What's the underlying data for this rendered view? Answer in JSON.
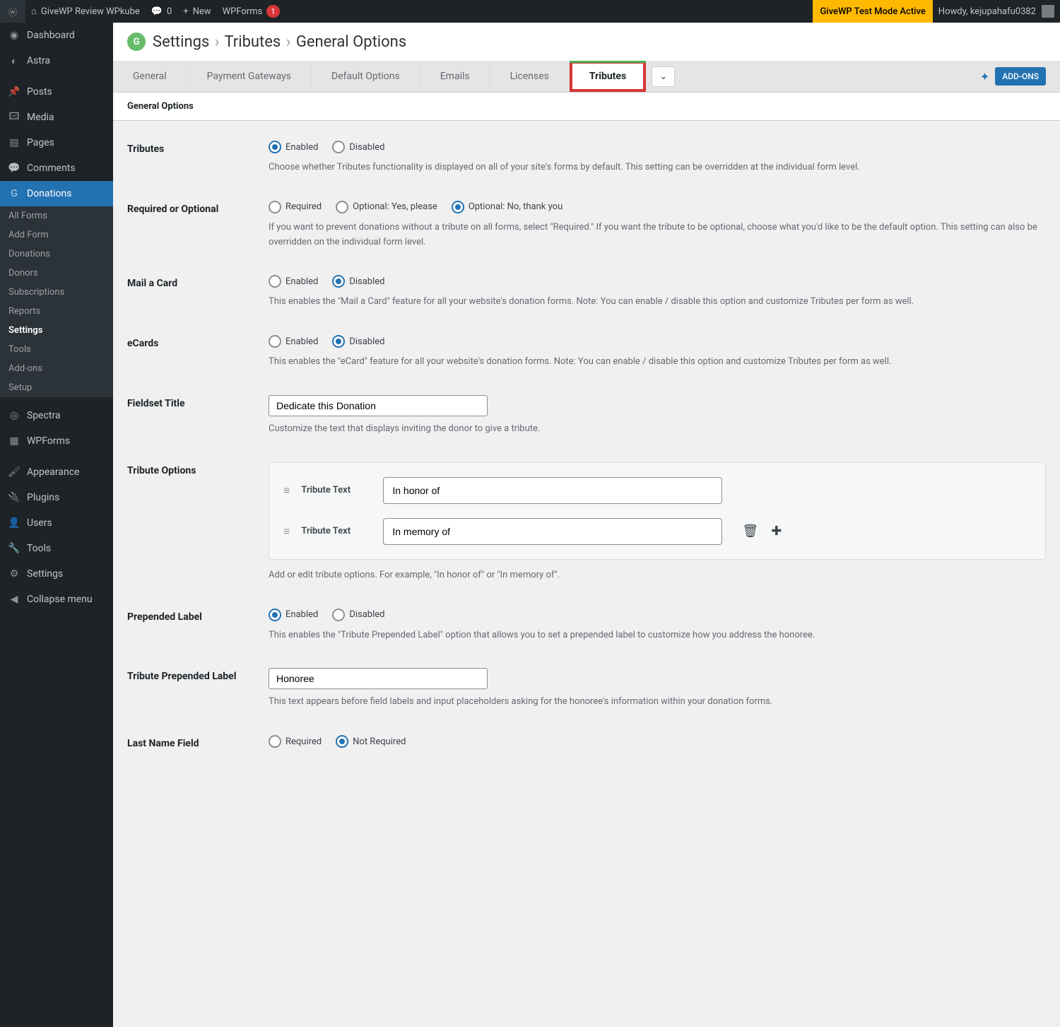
{
  "topbar": {
    "site_name": "GiveWP Review WPkube",
    "comments_count": "0",
    "new_label": "New",
    "wpforms_label": "WPForms",
    "wpforms_badge": "1",
    "test_mode": "GiveWP Test Mode Active",
    "howdy": "Howdy, kejupahafu0382"
  },
  "sidebar": {
    "items": [
      {
        "icon": "dashboard",
        "label": "Dashboard"
      },
      {
        "icon": "astra",
        "label": "Astra"
      },
      {
        "icon": "pin",
        "label": "Posts"
      },
      {
        "icon": "media",
        "label": "Media"
      },
      {
        "icon": "page",
        "label": "Pages"
      },
      {
        "icon": "comment",
        "label": "Comments"
      },
      {
        "icon": "give",
        "label": "Donations"
      }
    ],
    "submenu": [
      {
        "label": "All Forms"
      },
      {
        "label": "Add Form"
      },
      {
        "label": "Donations"
      },
      {
        "label": "Donors"
      },
      {
        "label": "Subscriptions"
      },
      {
        "label": "Reports"
      },
      {
        "label": "Settings",
        "active": true
      },
      {
        "label": "Tools"
      },
      {
        "label": "Add-ons"
      },
      {
        "label": "Setup"
      }
    ],
    "bottom": [
      {
        "icon": "spectra",
        "label": "Spectra"
      },
      {
        "icon": "wpforms",
        "label": "WPForms"
      },
      {
        "icon": "appearance",
        "label": "Appearance"
      },
      {
        "icon": "plugins",
        "label": "Plugins"
      },
      {
        "icon": "users",
        "label": "Users"
      },
      {
        "icon": "tools",
        "label": "Tools"
      },
      {
        "icon": "settings",
        "label": "Settings"
      },
      {
        "icon": "collapse",
        "label": "Collapse menu"
      }
    ]
  },
  "heading": {
    "crumb1": "Settings",
    "crumb2": "Tributes",
    "crumb3": "General Options"
  },
  "tabs": {
    "items": [
      "General",
      "Payment Gateways",
      "Default Options",
      "Emails",
      "Licenses",
      "Tributes"
    ],
    "addons": "ADD-ONS"
  },
  "subnav": "General Options",
  "options": {
    "enabled": "Enabled",
    "disabled": "Disabled",
    "required": "Required",
    "not_required": "Not Required",
    "optional_yes": "Optional: Yes, please",
    "optional_no": "Optional: No, thank you"
  },
  "rows": {
    "tributes": {
      "label": "Tributes",
      "desc": "Choose whether Tributes functionality is displayed on all of your site's forms by default. This setting can be overridden at the individual form level."
    },
    "required": {
      "label": "Required or Optional",
      "desc": "If you want to prevent donations without a tribute on all forms, select \"Required.\" If you want the tribute to be optional, choose what you'd like to be the default option. This setting can also be overridden on the individual form level."
    },
    "mail_card": {
      "label": "Mail a Card",
      "desc": "This enables the \"Mail a Card\" feature for all your website's donation forms. Note: You can enable / disable this option and customize Tributes per form as well."
    },
    "ecards": {
      "label": "eCards",
      "desc": "This enables the \"eCard\" feature for all your website's donation forms. Note: You can enable / disable this option and customize Tributes per form as well."
    },
    "fieldset": {
      "label": "Fieldset Title",
      "value": "Dedicate this Donation",
      "desc": "Customize the text that displays inviting the donor to give a tribute."
    },
    "tribute_opts": {
      "label": "Tribute Options",
      "text_label": "Tribute Text",
      "r1": "In honor of",
      "r2": "In memory of",
      "desc": "Add or edit tribute options. For example, \"In honor of\" or \"In memory of\"."
    },
    "prepended": {
      "label": "Prepended Label",
      "desc": "This enables the \"Tribute Prepended Label\" option that allows you to set a prepended label to customize how you address the honoree."
    },
    "prepended_label": {
      "label": "Tribute Prepended Label",
      "value": "Honoree",
      "desc": "This text appears before field labels and input placeholders asking for the honoree's information within your donation forms."
    },
    "last_name": {
      "label": "Last Name Field"
    }
  }
}
